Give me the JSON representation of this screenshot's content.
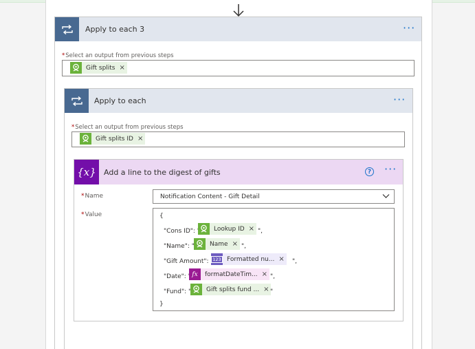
{
  "outer_loop": {
    "title": "Apply to each 3",
    "menu": "···",
    "select_label": "Select an output from previous steps",
    "required_mark": "*",
    "token": "Gift splits",
    "token_remove": "×"
  },
  "inner_loop": {
    "title": "Apply to each",
    "menu": "···",
    "select_label": "Select an output from previous steps",
    "required_mark": "*",
    "token": "Gift splits ID",
    "token_remove": "×"
  },
  "compose": {
    "title": "Add a line to the digest of gifts",
    "icon_text": "{x}",
    "help": "?",
    "menu": "···",
    "name_label": "Name",
    "name_value": "Notification Content - Gift Detail",
    "value_label": "Value",
    "required_mark": "*",
    "open_brace": "{",
    "close_brace": "}",
    "lines": [
      {
        "key": "\"Cons ID\": \"",
        "token": "Lookup ID",
        "suffix": "\",",
        "token_kind": "dynamic"
      },
      {
        "key": "\"Name\": \"",
        "token": "Name",
        "suffix": "\",",
        "token_kind": "dynamic"
      },
      {
        "key": "\"Gift Amount\": \"",
        "token": "Formatted nu...",
        "suffix": "\",",
        "token_kind": "number"
      },
      {
        "key": "\"Date\": \"",
        "token": "formatDateTim...",
        "suffix": "\",",
        "token_kind": "expression"
      },
      {
        "key": "\"Fund\": \"",
        "token": "Gift splits fund ...",
        "suffix": "\"",
        "token_kind": "dynamic"
      }
    ],
    "token_remove": "×",
    "number_icon_text": "123",
    "fx_icon_text": "fx"
  },
  "colors": {
    "loop_header": "#e1e6ee",
    "loop_icon": "#486991",
    "compose_header": "#ecd8f3",
    "compose_icon": "#730ea9",
    "accent": "#1a73c9",
    "token_green": "#6bb23b",
    "token_purple": "#6d5bc0",
    "token_pink": "#9a1a93"
  }
}
